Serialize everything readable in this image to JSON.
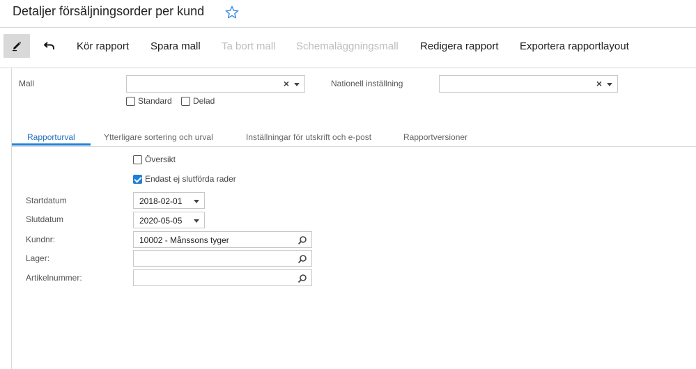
{
  "header": {
    "title": "Detaljer försäljningsorder per kund"
  },
  "toolbar": {
    "run_report": "Kör rapport",
    "save_template": "Spara mall",
    "delete_template": "Ta bort mall",
    "schedule_template": "Schemaläggningsmall",
    "edit_report": "Redigera rapport",
    "export_layout": "Exportera rapportlayout"
  },
  "template_section": {
    "mall_label": "Mall",
    "mall_value": "",
    "standard_label": "Standard",
    "standard_checked": false,
    "shared_label": "Delad",
    "shared_checked": false,
    "locale_label": "Nationell inställning",
    "locale_value": ""
  },
  "tabs": [
    {
      "label": "Rapporturval",
      "active": true
    },
    {
      "label": "Ytterligare sortering och urval",
      "active": false
    },
    {
      "label": "Inställningar för utskrift och e-post",
      "active": false
    },
    {
      "label": "Rapportversioner",
      "active": false
    }
  ],
  "form": {
    "overview_label": "Översikt",
    "overview_checked": false,
    "open_only_label": "Endast ej slutförda rader",
    "open_only_checked": true,
    "start_date_label": "Startdatum",
    "start_date_value": "2018-02-01",
    "end_date_label": "Slutdatum",
    "end_date_value": "2020-05-05",
    "customer_label": "Kundnr:",
    "customer_value": "10002 - Månssons tyger",
    "warehouse_label": "Lager:",
    "warehouse_value": "",
    "item_label": "Artikelnummer:",
    "item_value": ""
  },
  "colors": {
    "accent": "#1e7fd6",
    "star": "#3a8ee6",
    "disabled_text": "#bdbdbd"
  }
}
